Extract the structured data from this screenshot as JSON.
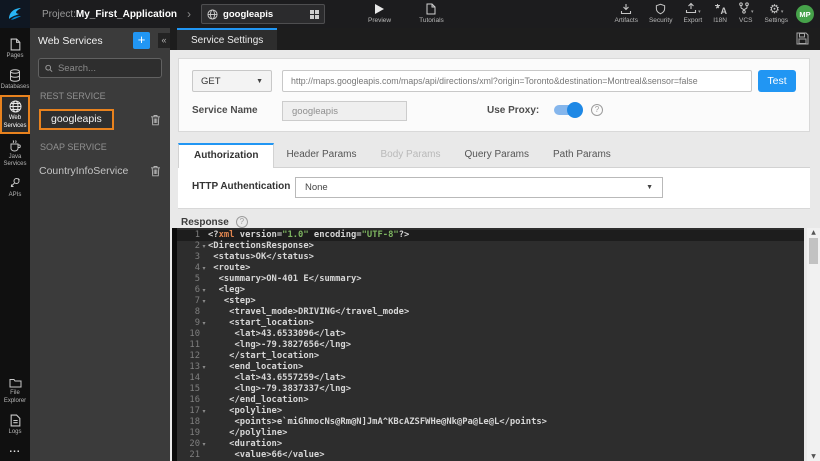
{
  "topbar": {
    "project_label": "Project:",
    "project_name": "My_First_Application",
    "service_selector_value": "googleapis",
    "preview_label": "Preview",
    "tutorials_label": "Tutorials",
    "artifacts_label": "Artifacts",
    "security_label": "Security",
    "export_label": "Export",
    "i18n_label": "I18N",
    "vcs_label": "VCS",
    "settings_label": "Settings",
    "avatar_initials": "MP"
  },
  "sidebar": {
    "items": [
      {
        "label": "Pages",
        "active": false
      },
      {
        "label": "Databases",
        "active": false
      },
      {
        "label": "Web Services",
        "active": true
      },
      {
        "label": "Java Services",
        "active": false
      },
      {
        "label": "APIs",
        "active": false
      }
    ],
    "bottom_items": [
      {
        "label": "File Explorer"
      },
      {
        "label": "Logs"
      }
    ],
    "more_label": "..."
  },
  "services_panel": {
    "title": "Web Services",
    "add_button": "+",
    "collapse_button": "«",
    "search_placeholder": "Search...",
    "rest_section": "REST SERVICE",
    "rest_items": [
      {
        "name": "googleapis",
        "selected": true
      }
    ],
    "soap_section": "SOAP SERVICE",
    "soap_items": [
      {
        "name": "CountryInfoService",
        "selected": false
      }
    ]
  },
  "main": {
    "tab_label": "Service Settings",
    "request": {
      "method": "GET",
      "url": "http://maps.googleapis.com/maps/api/directions/xml?origin=Toronto&destination=Montreal&sensor=false",
      "test_label": "Test",
      "service_name_label": "Service Name",
      "service_name_value": "googleapis",
      "use_proxy_label": "Use Proxy:",
      "use_proxy_on": true
    },
    "param_tabs": [
      {
        "label": "Authorization",
        "state": "active"
      },
      {
        "label": "Header Params",
        "state": "normal"
      },
      {
        "label": "Body Params",
        "state": "disabled"
      },
      {
        "label": "Query Params",
        "state": "normal"
      },
      {
        "label": "Path Params",
        "state": "normal"
      }
    ],
    "authorization": {
      "http_auth_label": "HTTP Authentication",
      "http_auth_value": "None"
    },
    "response_label": "Response"
  },
  "colors": {
    "accent_blue": "#2196f3",
    "selection_orange": "#e8821e",
    "avatar_green": "#46a24a"
  },
  "editor": {
    "lines": [
      {
        "n": 1,
        "fold": false,
        "active": true,
        "seg": [
          {
            "t": "<?",
            "c": "d"
          },
          {
            "t": "xml",
            "c": "o"
          },
          {
            "t": " version=",
            "c": "d"
          },
          {
            "t": "\"1.0\"",
            "c": "g"
          },
          {
            "t": " encoding=",
            "c": "d"
          },
          {
            "t": "\"UTF-8\"",
            "c": "g"
          },
          {
            "t": "?>",
            "c": "d"
          }
        ]
      },
      {
        "n": 2,
        "fold": true,
        "seg": [
          {
            "t": "<DirectionsResponse>",
            "c": "d"
          }
        ]
      },
      {
        "n": 3,
        "fold": false,
        "seg": [
          {
            "t": " <status>OK</status>",
            "c": "d"
          }
        ]
      },
      {
        "n": 4,
        "fold": true,
        "seg": [
          {
            "t": " <route>",
            "c": "d"
          }
        ]
      },
      {
        "n": 5,
        "fold": false,
        "seg": [
          {
            "t": "  <summary>ON-401 E</summary>",
            "c": "d"
          }
        ]
      },
      {
        "n": 6,
        "fold": true,
        "seg": [
          {
            "t": "  <leg>",
            "c": "d"
          }
        ]
      },
      {
        "n": 7,
        "fold": true,
        "seg": [
          {
            "t": "   <step>",
            "c": "d"
          }
        ]
      },
      {
        "n": 8,
        "fold": false,
        "seg": [
          {
            "t": "    <travel_mode>DRIVING</travel_mode>",
            "c": "d"
          }
        ]
      },
      {
        "n": 9,
        "fold": true,
        "seg": [
          {
            "t": "    <start_location>",
            "c": "d"
          }
        ]
      },
      {
        "n": 10,
        "fold": false,
        "seg": [
          {
            "t": "     <lat>43.6533096</lat>",
            "c": "d"
          }
        ]
      },
      {
        "n": 11,
        "fold": false,
        "seg": [
          {
            "t": "     <lng>-79.3827656</lng>",
            "c": "d"
          }
        ]
      },
      {
        "n": 12,
        "fold": false,
        "seg": [
          {
            "t": "    </start_location>",
            "c": "d"
          }
        ]
      },
      {
        "n": 13,
        "fold": true,
        "seg": [
          {
            "t": "    <end_location>",
            "c": "d"
          }
        ]
      },
      {
        "n": 14,
        "fold": false,
        "seg": [
          {
            "t": "     <lat>43.6557259</lat>",
            "c": "d"
          }
        ]
      },
      {
        "n": 15,
        "fold": false,
        "seg": [
          {
            "t": "     <lng>-79.3837337</lng>",
            "c": "d"
          }
        ]
      },
      {
        "n": 16,
        "fold": false,
        "seg": [
          {
            "t": "    </end_location>",
            "c": "d"
          }
        ]
      },
      {
        "n": 17,
        "fold": true,
        "seg": [
          {
            "t": "    <polyline>",
            "c": "d"
          }
        ]
      },
      {
        "n": 18,
        "fold": false,
        "seg": [
          {
            "t": "     <points>e`miGhmocNs@Rm@N]JmA^KBcAZSFWHe@Nk@Pa@Le@L</points>",
            "c": "d"
          }
        ]
      },
      {
        "n": 19,
        "fold": false,
        "seg": [
          {
            "t": "    </polyline>",
            "c": "d"
          }
        ]
      },
      {
        "n": 20,
        "fold": true,
        "seg": [
          {
            "t": "    <duration>",
            "c": "d"
          }
        ]
      },
      {
        "n": 21,
        "fold": false,
        "seg": [
          {
            "t": "     <value>66</value>",
            "c": "d"
          }
        ]
      }
    ]
  }
}
